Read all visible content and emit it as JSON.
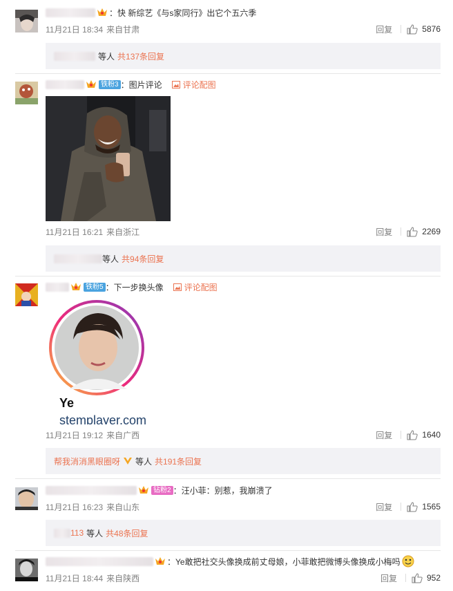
{
  "comments": [
    {
      "text": "：快 新综艺《与s家同行》出它个五六季",
      "date": "11月21日 18:34",
      "location": "来自甘肃",
      "reply_label": "回复",
      "likes": "5876",
      "sub_prefix": "等人",
      "sub_count": "共137条回复"
    },
    {
      "fan_badge": "铁粉3",
      "text": "：图片评论",
      "pic_label": "评论配图",
      "date": "11月21日 16:21",
      "location": "来自浙江",
      "reply_label": "回复",
      "likes": "2269",
      "sub_prefix": "等人",
      "sub_count": "共94条回复"
    },
    {
      "fan_badge": "铁粉5",
      "text": "：下一步换头像",
      "pic_label": "评论配图",
      "image_text_1": "Ye",
      "image_text_2": "stemplayer.com",
      "date": "11月21日 19:12",
      "location": "来自广西",
      "reply_label": "回复",
      "likes": "1640",
      "sub_name": "帮我消消黑眼圈呀",
      "sub_prefix": "等人",
      "sub_count": "共191条回复"
    },
    {
      "fan_badge": "钻粉2",
      "text": "：汪小菲：别惹，我崩溃了",
      "date": "11月21日 16:23",
      "location": "来自山东",
      "reply_label": "回复",
      "likes": "1565",
      "sub_name": "113",
      "sub_prefix": "等人",
      "sub_count": "共48条回复"
    },
    {
      "text": "：Ye敢把社交头像换成前丈母娘，小菲敢把微博头像换成小梅吗",
      "date": "11月21日 18:44",
      "location": "来自陕西",
      "reply_label": "回复",
      "likes": "952"
    }
  ],
  "colors": {
    "accent": "#eb7350",
    "fan_blue": "#4aa3df",
    "fan_pink": "#e86cc3",
    "sub_bg": "#f2f2f5"
  }
}
